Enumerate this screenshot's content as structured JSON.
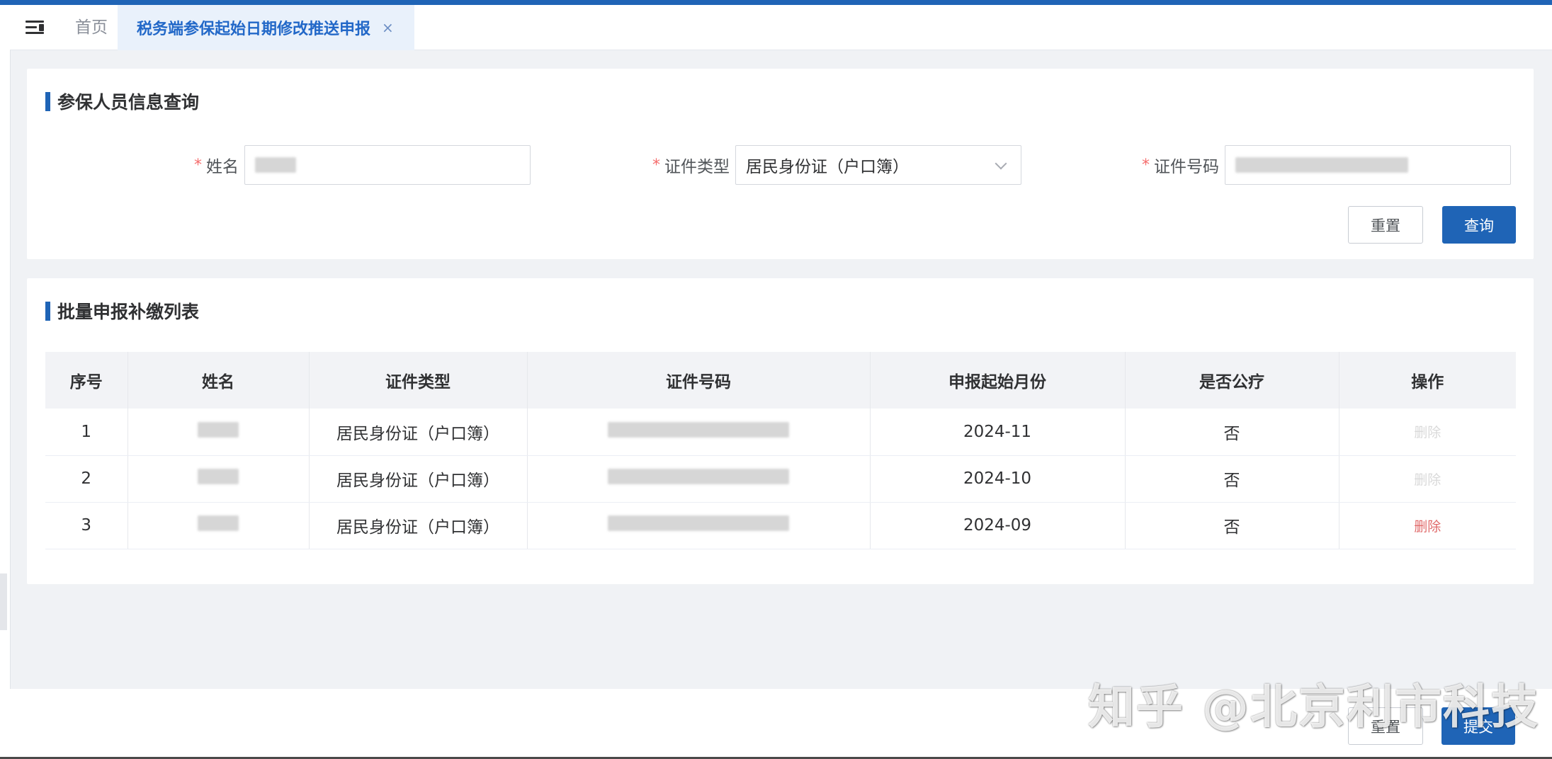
{
  "tabs": {
    "home": "首页",
    "active": "税务端参保起始日期修改推送申报",
    "close": "×"
  },
  "query": {
    "title": "参保人员信息查询",
    "required_mark": "*",
    "name_label": "姓名",
    "id_type_label": "证件类型",
    "id_type_value": "居民身份证（户口簿）",
    "id_number_label": "证件号码",
    "reset_label": "重置",
    "search_label": "查询"
  },
  "list": {
    "title": "批量申报补缴列表",
    "columns": [
      "序号",
      "姓名",
      "证件类型",
      "证件号码",
      "申报起始月份",
      "是否公疗",
      "操作"
    ],
    "rows": [
      {
        "seq": "1",
        "id_type": "居民身份证（户口簿）",
        "start_month": "2024-11",
        "public_medical": "否",
        "action": "删除",
        "action_enabled": false
      },
      {
        "seq": "2",
        "id_type": "居民身份证（户口簿）",
        "start_month": "2024-10",
        "public_medical": "否",
        "action": "删除",
        "action_enabled": false
      },
      {
        "seq": "3",
        "id_type": "居民身份证（户口簿）",
        "start_month": "2024-09",
        "public_medical": "否",
        "action": "删除",
        "action_enabled": true
      }
    ]
  },
  "footer": {
    "reset_label": "重置",
    "submit_label": "提交"
  },
  "watermark": "知乎 @北京利市科技",
  "colors": {
    "primary": "#1f64b6",
    "danger": "#e06a6a",
    "disabled": "#d9d9d9"
  }
}
